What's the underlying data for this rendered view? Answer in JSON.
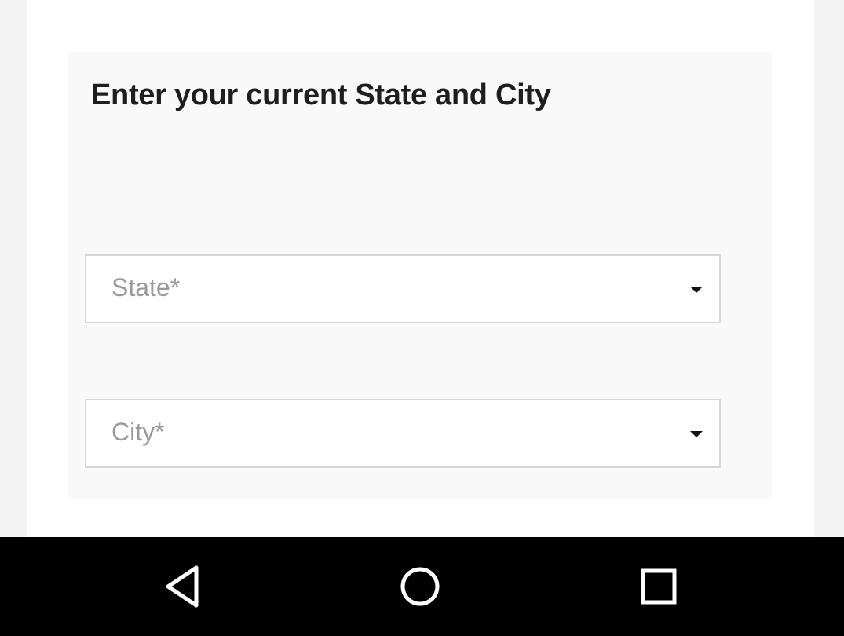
{
  "form": {
    "title": "Enter your current State and City",
    "state_select": {
      "placeholder": "State*",
      "selected_value": "",
      "icon": "dropdown-arrow-icon"
    },
    "city_select": {
      "placeholder": "City*",
      "selected_value": "",
      "icon": "dropdown-arrow-icon"
    }
  },
  "system_nav": {
    "background": "#000000",
    "buttons": [
      {
        "icon": "back-triangle-icon"
      },
      {
        "icon": "home-circle-icon"
      },
      {
        "icon": "recents-square-icon"
      }
    ]
  },
  "colors": {
    "page_background": "#f3f3f3",
    "card_background": "#f9f9f9",
    "title_text": "#1e1e1e",
    "placeholder_text": "#9a9a9a",
    "field_border": "#d6d6d6"
  }
}
